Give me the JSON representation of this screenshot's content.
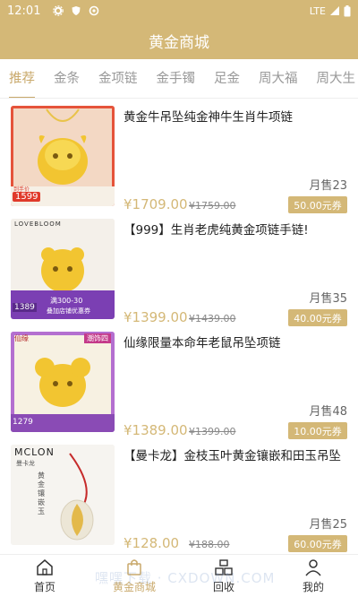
{
  "status": {
    "time": "12:01",
    "network": "LTE"
  },
  "header": {
    "title": "黄金商城"
  },
  "tabs": [
    "推荐",
    "金条",
    "金项链",
    "金手镯",
    "足金",
    "周大福",
    "周大生"
  ],
  "products": [
    {
      "title": "黄金牛吊坠纯金神牛生肖牛项链",
      "monthly": "月售23",
      "price": "¥1709.00",
      "original": "¥1759.00",
      "coupon": "50.00元券",
      "thumb_tags": [
        "1599",
        "到手价"
      ]
    },
    {
      "title": "【999】生肖老虎纯黄金项链手链!",
      "monthly": "月售35",
      "price": "¥1399.00",
      "original": "¥1439.00",
      "coupon": "40.00元券",
      "thumb_tags": [
        "LOVEBLOOM",
        "满300-30",
        "叠加店铺优惠券",
        "1389"
      ]
    },
    {
      "title": "仙缘限量本命年老鼠吊坠项链",
      "monthly": "月售48",
      "price": "¥1389.00",
      "original": "¥1399.00",
      "coupon": "10.00元券",
      "thumb_tags": [
        "仙缘",
        "潮饰四",
        "1279"
      ]
    },
    {
      "title": "【曼卡龙】金枝玉叶黄金镶嵌和田玉吊坠",
      "monthly": "月售25",
      "price": "¥128.00",
      "original": "¥188.00",
      "coupon": "60.00元券",
      "thumb_tags": [
        "MCLON",
        "曼卡龙",
        "黄金镶嵌玉"
      ]
    }
  ],
  "bottom_nav": [
    {
      "label": "首页",
      "icon": "home-icon"
    },
    {
      "label": "黄金商城",
      "icon": "shopping-bag-icon"
    },
    {
      "label": "回收",
      "icon": "recycle-icon"
    },
    {
      "label": "我的",
      "icon": "user-icon"
    }
  ],
  "watermark": "嘿嘿下载 · CXDOWN.COM",
  "colors": {
    "accent": "#d4b877",
    "price": "#d4b877",
    "header_bg": "#d4b877"
  }
}
